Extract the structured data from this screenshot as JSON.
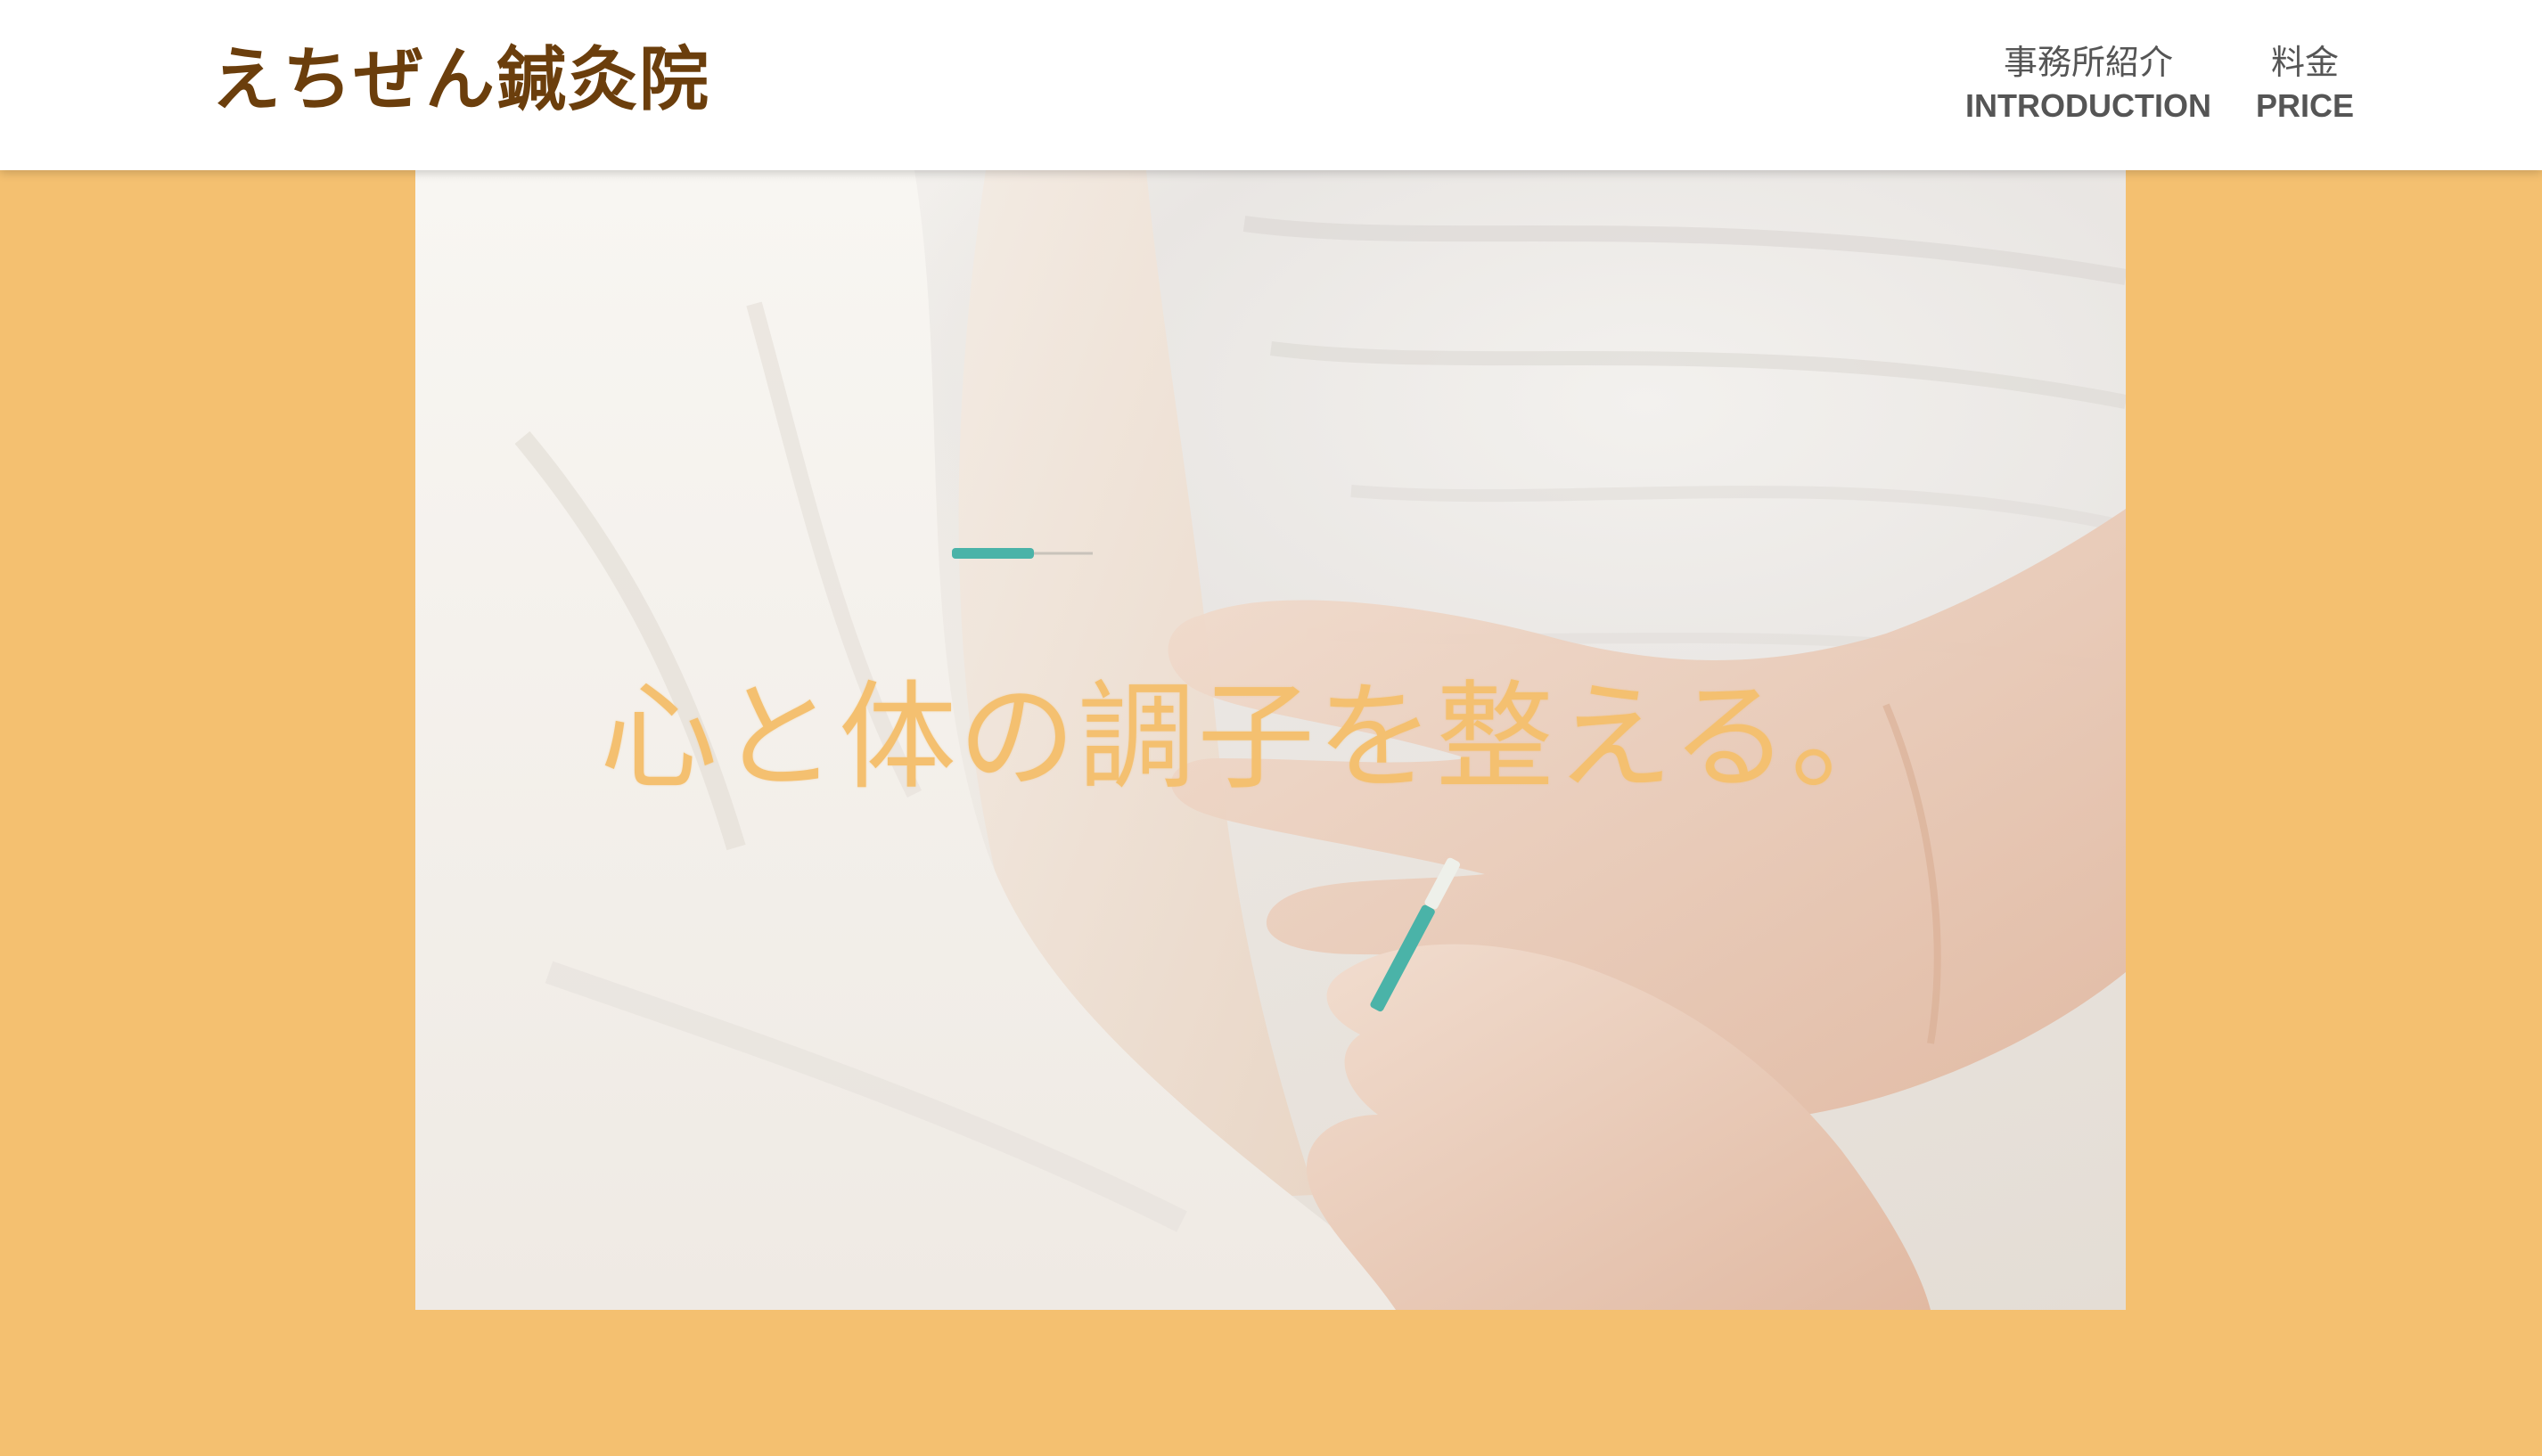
{
  "header": {
    "logo": "えちぜん鍼灸院",
    "nav": [
      {
        "jp": "事務所紹介",
        "en": "INTRODUCTION"
      },
      {
        "jp": "料金",
        "en": "PRICE"
      }
    ]
  },
  "hero": {
    "slogan": "心と体の調子を整える。",
    "image_icon": "acupuncture-photo-icon"
  },
  "colors": {
    "background": "#F4C070",
    "logo": "#6B3E0C",
    "nav_text": "#555555",
    "slogan": "#F4C070",
    "header": "#FFFFFF"
  }
}
